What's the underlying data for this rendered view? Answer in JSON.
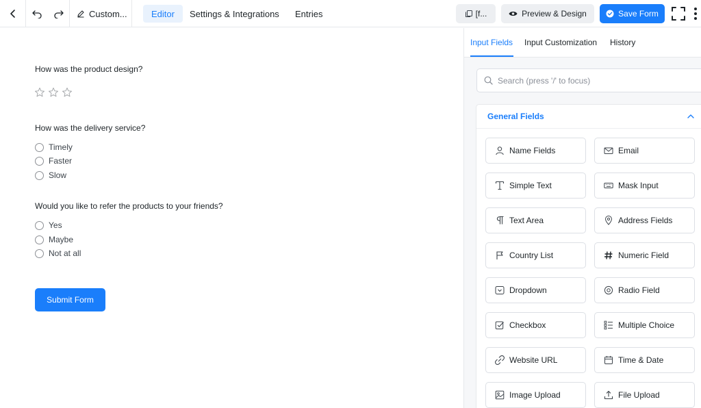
{
  "topbar": {
    "title": "Custom...",
    "nav": {
      "editor": "Editor",
      "settings": "Settings & Integrations",
      "entries": "Entries"
    },
    "shortcode_label": "[f...",
    "preview_label": "Preview & Design",
    "save_label": "Save Form"
  },
  "form": {
    "q1": "How was the product design?",
    "q2": "How was the delivery service?",
    "q2_options": [
      "Timely",
      "Faster",
      "Slow"
    ],
    "q3": "Would you like to refer the products to your friends?",
    "q3_options": [
      "Yes",
      "Maybe",
      "Not at all"
    ],
    "submit_label": "Submit Form"
  },
  "sidebar": {
    "tabs": [
      "Input Fields",
      "Input Customization",
      "History"
    ],
    "search_placeholder": "Search (press '/' to focus)",
    "section_title": "General Fields",
    "fields": [
      "Name Fields",
      "Email",
      "Simple Text",
      "Mask Input",
      "Text Area",
      "Address Fields",
      "Country List",
      "Numeric Field",
      "Dropdown",
      "Radio Field",
      "Checkbox",
      "Multiple Choice",
      "Website URL",
      "Time & Date",
      "Image Upload",
      "File Upload"
    ]
  },
  "colors": {
    "accent": "#1a7efb",
    "accent_bg": "#e9f2fd",
    "sidebar_bg": "#f6f7f9"
  }
}
